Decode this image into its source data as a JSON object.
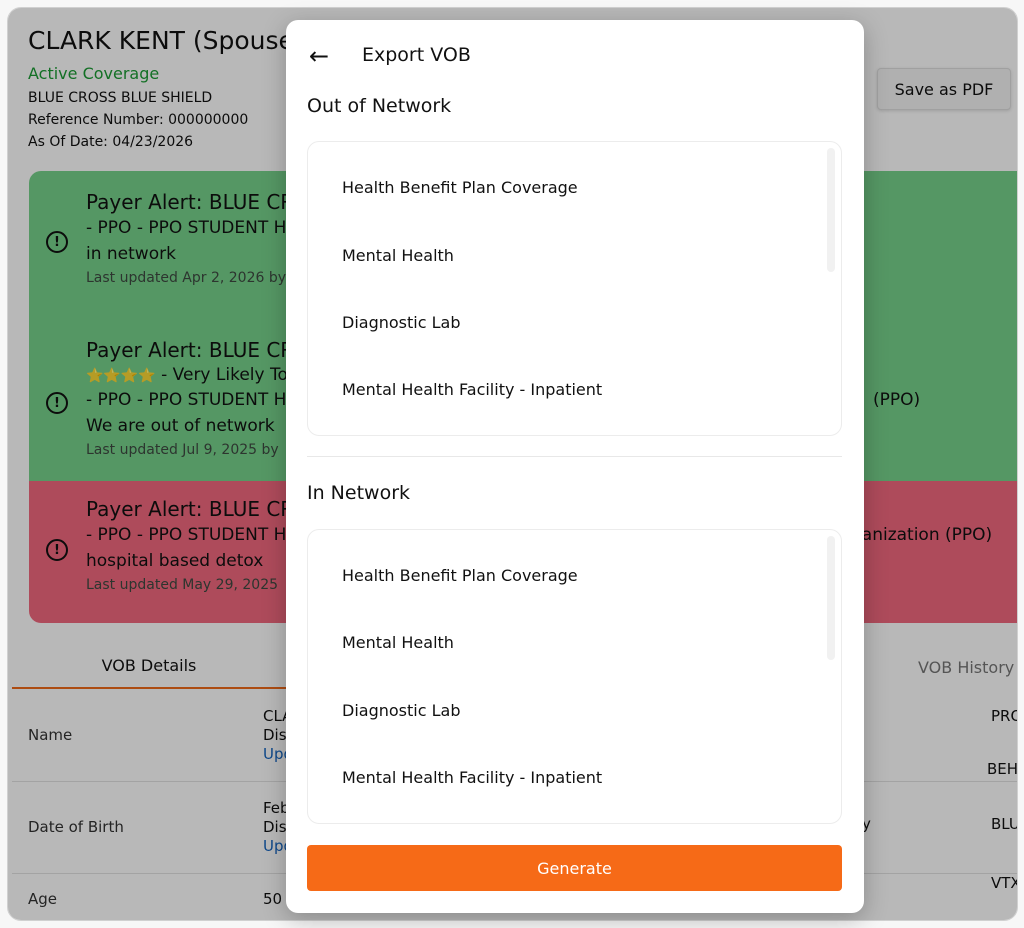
{
  "patient": {
    "name": "CLARK KENT (Spouse)",
    "coverage_status": "Active Coverage",
    "payer": "BLUE CROSS BLUE SHIELD",
    "reference": "Reference Number: 000000000",
    "as_of_date": "As Of Date: 04/23/2026"
  },
  "toolbar": {
    "save_pdf_label": "Save as PDF"
  },
  "alerts": [
    {
      "title": "Payer Alert: BLUE CRO",
      "line1": "- PPO - PPO STUDENT HE",
      "line2": "in network",
      "updated": "Last updated Apr 2, 2026 by"
    },
    {
      "title": "Payer Alert: BLUE CRO",
      "stars": "⭐⭐⭐⭐",
      "line0": " - Very Likely To",
      "line1": "- PPO - PPO STUDENT HE",
      "line1_right": "(PPO)",
      "line2": "We are out of network",
      "updated": "Last updated Jul 9, 2025 by"
    },
    {
      "title": "Payer Alert: BLUE CRO",
      "line1": "- PPO - PPO STUDENT HE",
      "line1_right": "ganization (PPO)",
      "line2": "hospital based detox",
      "updated": "Last updated May 29, 2025"
    }
  ],
  "tabs": {
    "vob_details": "VOB Details",
    "vob_history": "VOB History"
  },
  "table": {
    "rows": [
      {
        "label": "Name",
        "val1": "CLA",
        "val2": "Dis",
        "link": "Upd",
        "mid": "",
        "right": "PRO"
      },
      {
        "label": "",
        "val1": "",
        "val2": "",
        "link": "",
        "mid": "",
        "right": "BEH"
      },
      {
        "label": "Date of Birth",
        "val1": "Feb",
        "val2": "Dis",
        "link": "Upd",
        "mid": "y",
        "right": "BLU"
      },
      {
        "label": "Age",
        "val1": "50",
        "val2": "",
        "link": "",
        "mid": "",
        "right": "VTX"
      }
    ]
  },
  "modal": {
    "title": "Export VOB",
    "out_of_network": {
      "heading": "Out of Network",
      "items": [
        "Health Benefit Plan Coverage",
        "Mental Health",
        "Diagnostic Lab",
        "Mental Health Facility - Inpatient"
      ]
    },
    "in_network": {
      "heading": "In Network",
      "items": [
        "Health Benefit Plan Coverage",
        "Mental Health",
        "Diagnostic Lab",
        "Mental Health Facility - Inpatient"
      ]
    },
    "generate_label": "Generate"
  },
  "colors": {
    "accent": "#f66a17",
    "alert_green": "#76d28b",
    "alert_red": "#f1697e",
    "active_coverage": "#1b9c34"
  }
}
